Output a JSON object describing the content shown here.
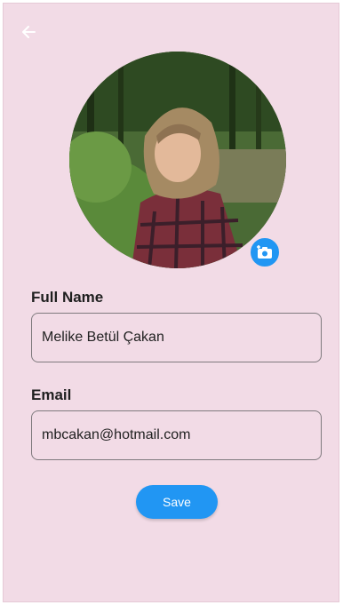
{
  "colors": {
    "background": "#f2dbe6",
    "accent": "#2196f3"
  },
  "header": {
    "back_icon": "arrow-left-icon"
  },
  "profile": {
    "photo_alt": "Profile photo",
    "change_photo_icon": "add-photo-camera-icon"
  },
  "form": {
    "full_name": {
      "label": "Full Name",
      "value": "Melike Betül Çakan"
    },
    "email": {
      "label": "Email",
      "value": "mbcakan@hotmail.com"
    }
  },
  "actions": {
    "save_label": "Save"
  }
}
